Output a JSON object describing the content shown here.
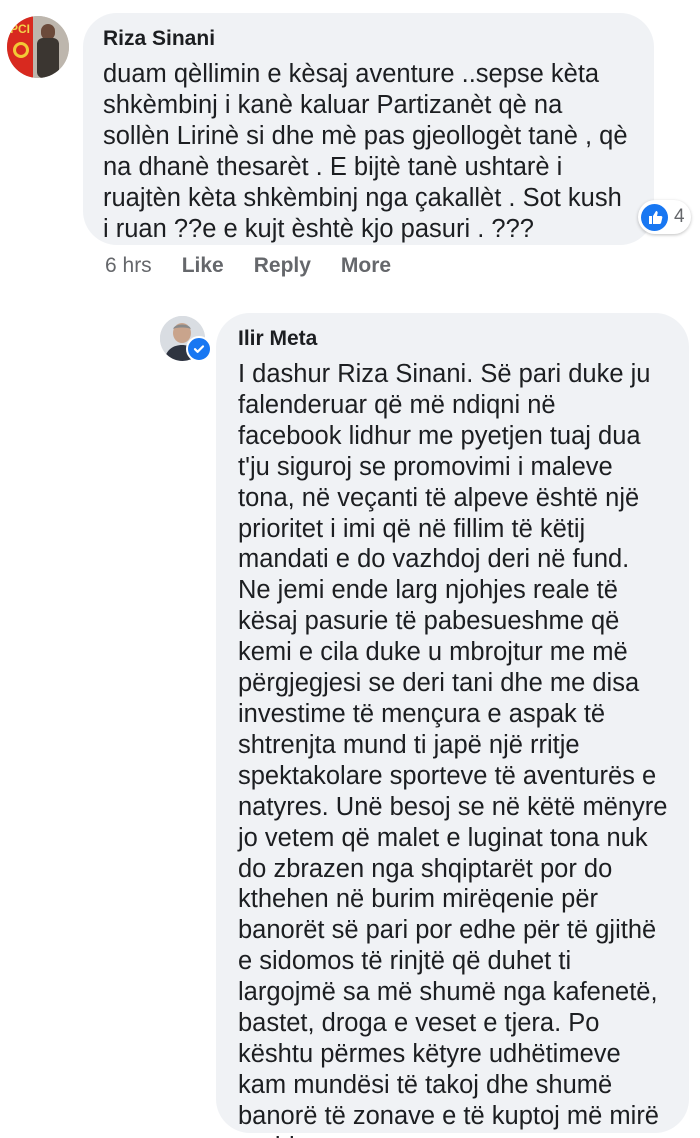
{
  "comments": [
    {
      "author": "Riza Sinani",
      "text": "duam qèllimin e kèsaj aventure ..sepse kèta\nshkèmbinj i kanè kaluar Partizanèt qè na\nsollèn Lirinè si dhe mè pas gjeollogèt tanè , qè\nna dhanè thesarèt . E bijtè tanè ushtarè i\nruajtèn kèta shkèmbinj nga çakallèt . Sot kush\ni ruan ??e e kujt èshtè kjo pasuri . ???",
      "reaction_count": "4",
      "time": "6 hrs",
      "actions": [
        "Like",
        "Reply",
        "More"
      ],
      "avatar_label": "PCI"
    },
    {
      "author": "Ilir Meta",
      "text": "I dashur Riza Sinani. Së pari duke ju\nfalenderuar që më ndiqni në\nfacebook lidhur me pyetjen tuaj dua\nt'ju siguroj se promovimi i maleve\ntona, në veçanti të alpeve është një\nprioritet i imi që në fillim të këtij\nmandati e do vazhdoj deri në fund.\nNe jemi ende larg njohjes reale të\nkësaj pasurie të pabesueshme që\nkemi e cila duke u mbrojtur me më\npërgjegjesi se deri tani dhe me disa\ninvestime të mençura e aspak të\nshtrenjta mund ti japë një rritje\nspektakolare sporteve të aventurës e\nnatyres. Unë besoj se në këtë mënyre\njo vetem që malet e luginat tona nuk\ndo zbrazen nga shqiptarët por do\nkthehen në burim mirëqenie për\nbanorët së pari por edhe për të gjithë\ne sidomos të rinjtë që duhet ti\nlargojmë sa më shumë nga kafenetë,\nbastet, droga e veset e tjera. Po\nkështu përmes këtyre udhëtimeve\nkam mundësi të takoj dhe shumë\nbanorë të zonave e të kuptoj më mirë\nproblemet e tyre."
    }
  ],
  "colors": {
    "bubble": "#f0f2f5",
    "secondary_text": "#65676b",
    "facebook_blue": "#1877f2"
  },
  "icons": [
    "like-icon",
    "verified-badge-icon"
  ]
}
